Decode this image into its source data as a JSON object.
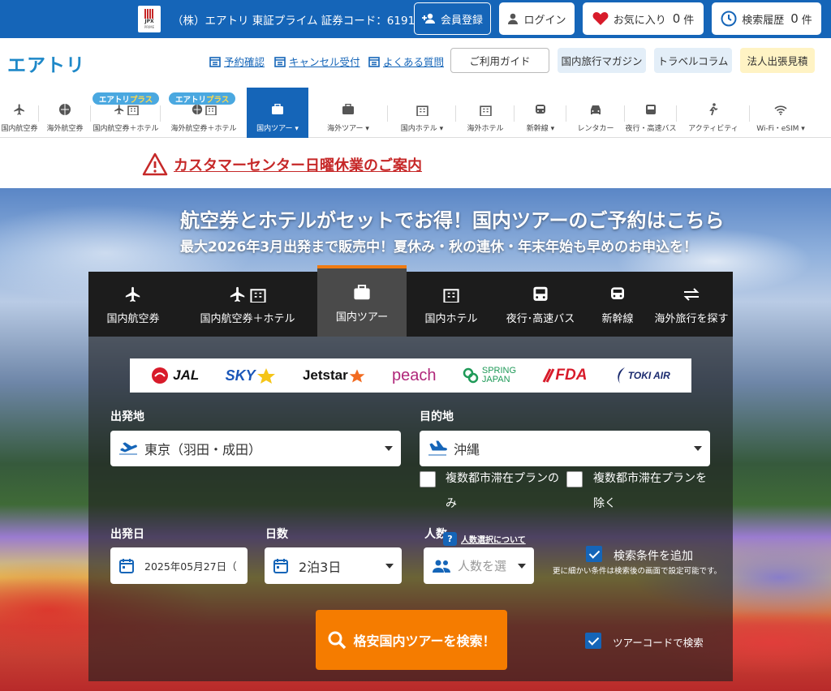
{
  "top": {
    "jpx_mark": "JPX",
    "jpx_sub": "PRIME",
    "company_text": "（株）エアトリ 東証プライム 証券コード：6191",
    "register_label": "会員登録",
    "login_label": "ログイン",
    "favorites_label": "お気に入り",
    "favorites_count": "0",
    "favorites_unit": "件",
    "history_label": "検索履歴",
    "history_count": "0",
    "history_unit": "件"
  },
  "header": {
    "logo": "エアトリ",
    "links": [
      "予約確認",
      "キャンセル受付",
      "よくある質問"
    ],
    "guide_label": "ご利用ガイド",
    "pills": [
      "国内旅行マガジン",
      "トラベルコラム",
      "法人出張見積"
    ]
  },
  "categories": [
    {
      "label": "国内航空券",
      "icon": "plane-icon"
    },
    {
      "label": "海外航空券",
      "icon": "globe-plane-icon"
    },
    {
      "label": "国内航空券＋ホテル",
      "icon": "plane-hotel-icon",
      "badge": "エアトリプラス"
    },
    {
      "label": "海外航空券＋ホテル",
      "icon": "globe-hotel-icon",
      "badge": "エアトリプラス"
    },
    {
      "label": "国内ツアー",
      "icon": "suitcase-icon",
      "active": true
    },
    {
      "label": "海外ツアー",
      "icon": "suitcase-icon"
    },
    {
      "label": "国内ホテル",
      "icon": "hotel-icon"
    },
    {
      "label": "海外ホテル",
      "icon": "hotel-icon"
    },
    {
      "label": "新幹線",
      "icon": "train-icon"
    },
    {
      "label": "レンタカー",
      "icon": "car-icon"
    },
    {
      "label": "夜行・高速バス",
      "icon": "bus-icon"
    },
    {
      "label": "アクティビティ",
      "icon": "activity-icon"
    },
    {
      "label": "Wi-Fi・eSIM",
      "icon": "wifi-icon"
    }
  ],
  "badge": {
    "air": "エアトリ",
    "plus": "プラス"
  },
  "notice": "カスタマーセンター日曜休業のご案内",
  "hero": {
    "title": "航空券とホテルがセットでお得！国内ツアーのご予約はこちら",
    "subtitle": "最大2026年3月出発まで販売中！夏休み・秋の連休・年末年始も早めのお申込を！"
  },
  "tabs": [
    "国内航空券",
    "国内航空券＋ホテル",
    "国内ツアー",
    "国内ホテル",
    "夜行･高速バス",
    "新幹線",
    "海外旅行を探す"
  ],
  "airlines": [
    "JAL",
    "SKY",
    "Jetstar",
    "peach",
    "SPRING",
    "JAPAN",
    "FDA",
    "TOKI AIR"
  ],
  "form": {
    "origin_label": "出発地",
    "origin_value": "東京（羽田・成田）",
    "dest_label": "目的地",
    "dest_value": "沖縄",
    "multi_only": "複数都市滞在プランのみ",
    "multi_exclude": "複数都市滞在プランを除く",
    "date_label": "出発日",
    "date_value": "2025年05月27日（",
    "days_label": "日数",
    "days_value": "2泊3日",
    "people_label": "人数",
    "people_help": "人数選択について",
    "people_placeholder": "人数を選",
    "more_label": "検索条件を追加",
    "more_note": "更に細かい条件は検索後の画面で設定可能です。",
    "search_label": "格安国内ツアーを検索！",
    "tourcode_label": "ツアーコードで検索"
  }
}
